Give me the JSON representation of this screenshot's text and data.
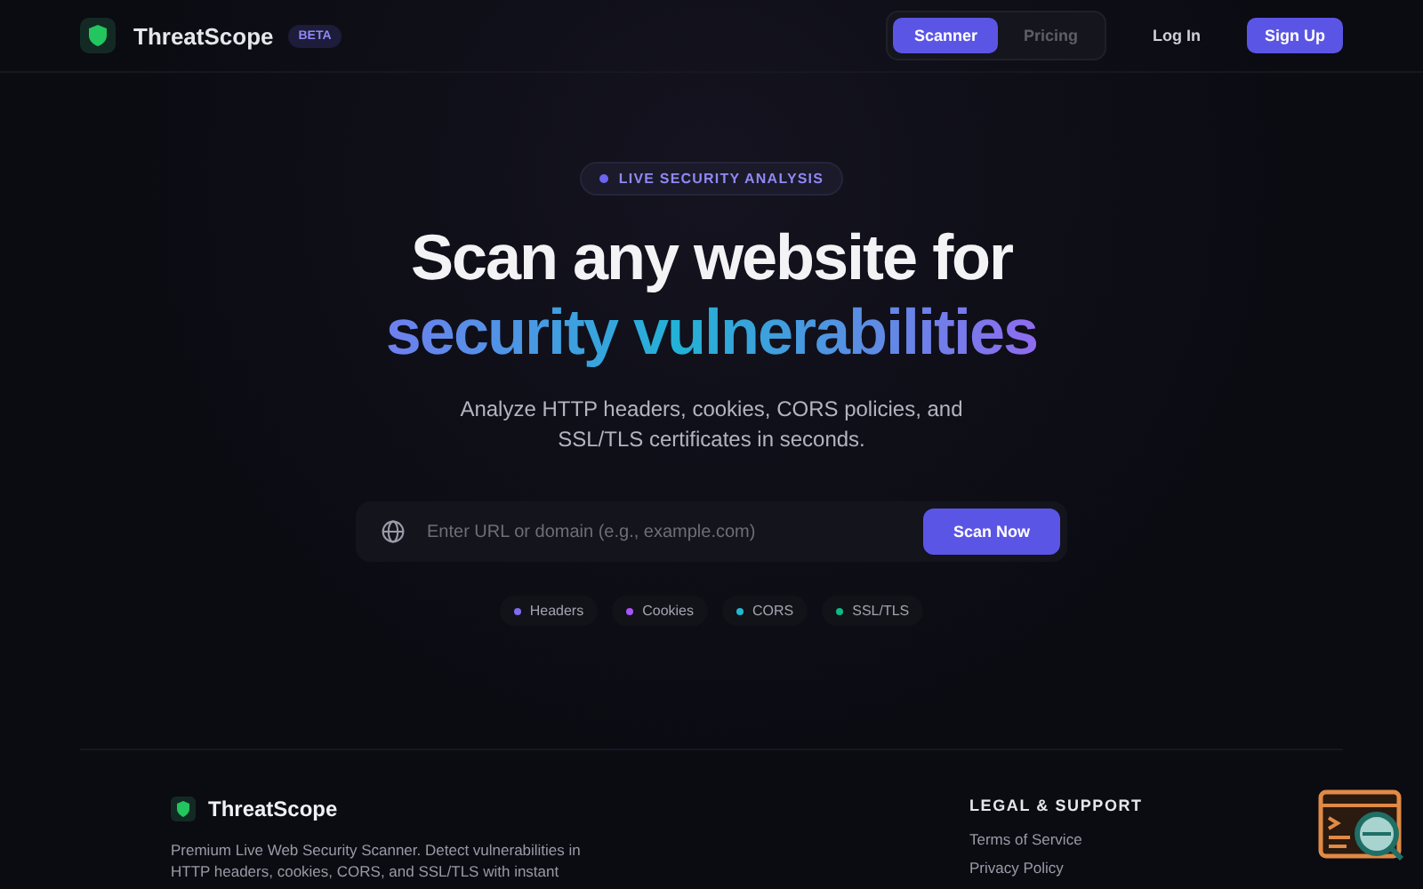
{
  "header": {
    "brand": "ThreatScope",
    "badge": "BETA",
    "nav": [
      {
        "label": "Scanner",
        "selected": true
      },
      {
        "label": "Pricing",
        "selected": false
      }
    ],
    "login": "Log In",
    "signup": "Sign Up"
  },
  "hero": {
    "badge": "LIVE SECURITY ANALYSIS",
    "title_line_1": "Scan any website for",
    "title_line_2": "security vulnerabilities",
    "subtitle": "Analyze HTTP headers, cookies, CORS policies, and SSL/TLS certificates in seconds.",
    "search": {
      "placeholder": "Enter URL or domain (e.g., example.com)",
      "button": "Scan Now"
    },
    "chips": [
      {
        "label": "Headers",
        "color": "#7c6cf0"
      },
      {
        "label": "Cookies",
        "color": "#a855f7"
      },
      {
        "label": "CORS",
        "color": "#22b8cf"
      },
      {
        "label": "SSL/TLS",
        "color": "#10b981"
      }
    ]
  },
  "footer": {
    "brand": "ThreatScope",
    "description": "Premium Live Web Security Scanner. Detect vulnerabilities in HTTP headers, cookies, CORS, and SSL/TLS with instant",
    "legal_heading": "LEGAL & SUPPORT",
    "links": [
      "Terms of Service",
      "Privacy Policy"
    ]
  }
}
